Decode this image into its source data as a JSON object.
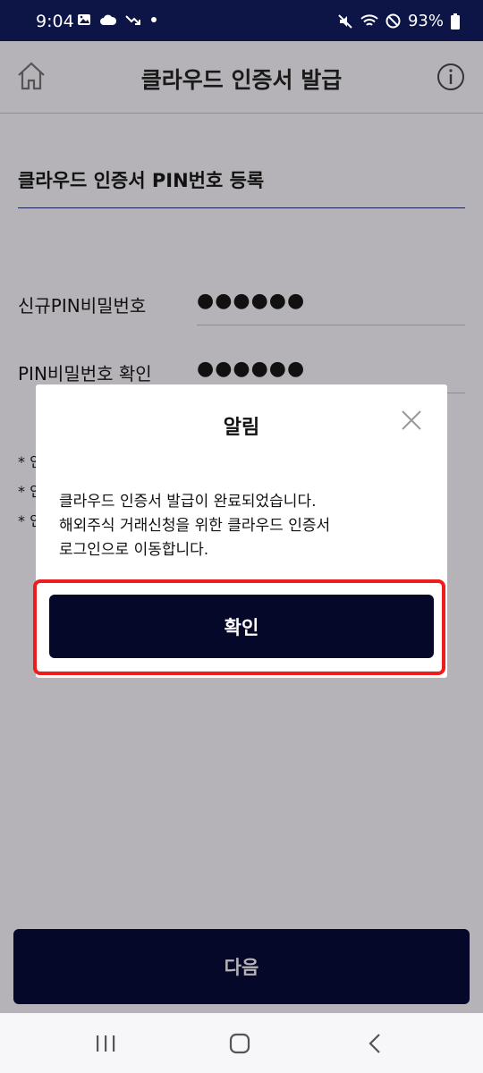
{
  "status_bar": {
    "time": "9:04",
    "battery": "93%"
  },
  "header": {
    "title": "클라우드 인증서 발급"
  },
  "section": {
    "title": "클라우드 인증서 PIN번호 등록"
  },
  "fields": [
    {
      "label": "신규PIN비밀번호",
      "value": "●●●●●●"
    },
    {
      "label": "PIN비밀번호 확인",
      "value": "●●●●●●"
    }
  ],
  "notes": [
    "* 인",
    "* 인",
    "* 인"
  ],
  "next_button": {
    "label": "다음"
  },
  "dialog": {
    "title": "알림",
    "message_lines": [
      "클라우드 인증서 발급이 완료되었습니다.",
      "해외주식 거래신청을 위한 클라우드 인증서",
      "로그인으로 이동합니다."
    ],
    "confirm_label": "확인"
  }
}
